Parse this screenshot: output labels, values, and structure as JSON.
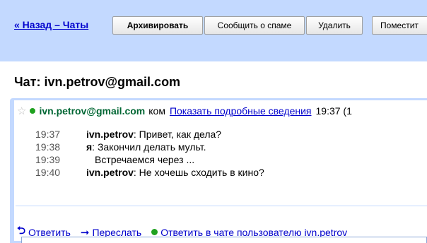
{
  "toolbar": {
    "back_label": "« Назад – Чаты",
    "archive_label": "Архивировать",
    "spam_label": "Сообщить о спаме",
    "delete_label": "Удалить",
    "move_label": "Поместит"
  },
  "chat": {
    "title": "Чат: ivn.petrov@gmail.com"
  },
  "message": {
    "sender": "ivn.petrov@gmail.com",
    "fragment": "ком",
    "details_link": "Показать подробные сведения",
    "time": "19:37 (1",
    "lines": [
      {
        "time": "19:37",
        "who": "ivn.petrov",
        "text": ": Привет, как дела?"
      },
      {
        "time": "19:38",
        "who": "я",
        "text": ": Закончил делать мульт."
      },
      {
        "time": "19:39",
        "who": "",
        "text": "Встречаемся через ..."
      },
      {
        "time": "19:40",
        "who": "ivn.petrov",
        "text": ": Не хочешь сходить в кино?"
      }
    ]
  },
  "actions": {
    "reply": "Ответить",
    "forward": "Переслать",
    "chat_reply": "Ответить в чате пользователю ivn.petrov"
  },
  "colors": {
    "toolbar_bg": "#c3d9ff",
    "link": "#0000cc",
    "online": "#1fa11f"
  },
  "icons": {
    "star": "star-icon",
    "reply": "reply-arrow-icon",
    "forward": "forward-arrow-icon",
    "status": "online-status-icon"
  }
}
